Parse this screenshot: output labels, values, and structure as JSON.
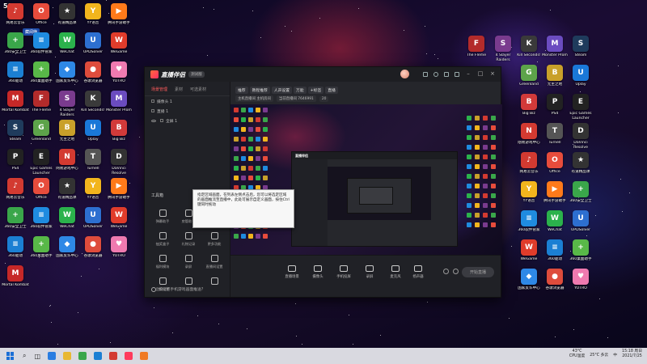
{
  "overlay": {
    "top_left_label": "5106",
    "badge": "藏阅嗨"
  },
  "desktop_icons": [
    {
      "label": "网易云音乐",
      "color": "#d33a31",
      "glyph": "♪"
    },
    {
      "label": "Office",
      "color": "#e74c3c",
      "glyph": "O"
    },
    {
      "label": "有道精品课",
      "color": "#333",
      "glyph": "★"
    },
    {
      "label": "YY语音",
      "color": "#f2b51d",
      "glyph": "Y"
    },
    {
      "label": "腾讯手游助手",
      "color": "#ff7a1a",
      "glyph": "▶"
    },
    {
      "label": "360安全卫士",
      "color": "#3aa64a",
      "glyph": "+"
    },
    {
      "label": "360软件管家",
      "color": "#1f8be0",
      "glyph": "≡"
    },
    {
      "label": "WeChat",
      "color": "#2bb24c",
      "glyph": "W"
    },
    {
      "label": "UPDSolver",
      "color": "#2d6fd0",
      "glyph": "U"
    },
    {
      "label": "WeGame",
      "color": "#e03c2b",
      "glyph": "W"
    },
    {
      "label": "360驱动",
      "color": "#1b7fd3",
      "glyph": "≡"
    },
    {
      "label": "360桌面助手",
      "color": "#58b848",
      "glyph": "+"
    },
    {
      "label": "国家反诈中心",
      "color": "#2e88e6",
      "glyph": "◆"
    },
    {
      "label": "谷歌浏览器",
      "color": "#de4c3c",
      "glyph": "●"
    },
    {
      "label": "YOTRO",
      "color": "#ef7ab0",
      "glyph": "♥"
    },
    {
      "label": "Mortal Kombat",
      "color": "#c62828",
      "glyph": "M"
    },
    {
      "label": "The Fleme",
      "color": "#b32b2b",
      "glyph": "F"
    },
    {
      "label": "4 Slayer Raiders",
      "color": "#7a3b8e",
      "glyph": "S"
    },
    {
      "label": "Kill Seconds!",
      "color": "#3a3a3a",
      "glyph": "K"
    },
    {
      "label": "Monster Prom",
      "color": "#6b4cc0",
      "glyph": "M"
    },
    {
      "label": "Steam",
      "color": "#1f3b5c",
      "glyph": "S"
    },
    {
      "label": "Greenland",
      "color": "#5da34a",
      "glyph": "G"
    },
    {
      "label": "无主之地",
      "color": "#c9a02a",
      "glyph": "B"
    },
    {
      "label": "Uplay",
      "color": "#1a78d8",
      "glyph": "U"
    },
    {
      "label": "Big Biz",
      "color": "#d23a3a",
      "glyph": "B"
    },
    {
      "label": "PS4",
      "color": "#222",
      "glyph": "P"
    },
    {
      "label": "Epic Games Launcher",
      "color": "#222",
      "glyph": "E"
    },
    {
      "label": "网易游戏中心",
      "color": "#d33a31",
      "glyph": "N"
    },
    {
      "label": "Turnell",
      "color": "#555",
      "glyph": "T"
    },
    {
      "label": "DaVinci Resolve",
      "color": "#333",
      "glyph": "D"
    }
  ],
  "app": {
    "brand": "直播伴侣",
    "version_tag": "测试版",
    "tabs": [
      "场景管理",
      "素材",
      "可选素材"
    ],
    "scenes": [
      "摄像头 1",
      "直播 1",
      "全屏 1"
    ],
    "top_chips": [
      "推荐",
      "教程推荐",
      "人声设置",
      "万能",
      "+标签",
      "直播"
    ],
    "room_info": [
      "主机直播间 主机房间",
      "当前直播间 7646991",
      "20"
    ],
    "tools_title": "工具箱",
    "tools": [
      "弹幕助手",
      "房管助手",
      "主播任务",
      "抽奖盒子",
      "礼物记录",
      "更多功能",
      "福利模块",
      "录屏",
      "直播间设置",
      "音频设置",
      "",
      ""
    ],
    "footer_help": "如何把手机游戏画面推送?",
    "bottom_buttons": [
      "直播场景",
      "摄像头",
      "手机投屏",
      "录屏",
      "麦克风",
      "扬声器"
    ],
    "start_button": "开始直播",
    "tooltip_text": "指定区域画面，在列表左侧点击后，您可以将选定区域的画面推流至直播中，此处可展示自定义画面，按住Ctrl键同时拖动"
  },
  "taskbar": {
    "temperature": "43°C",
    "cpu_label": "CPU温度",
    "weather": "25°C 多云",
    "lang": "中",
    "time": "15:18 周日",
    "date": "2021/7/25"
  }
}
